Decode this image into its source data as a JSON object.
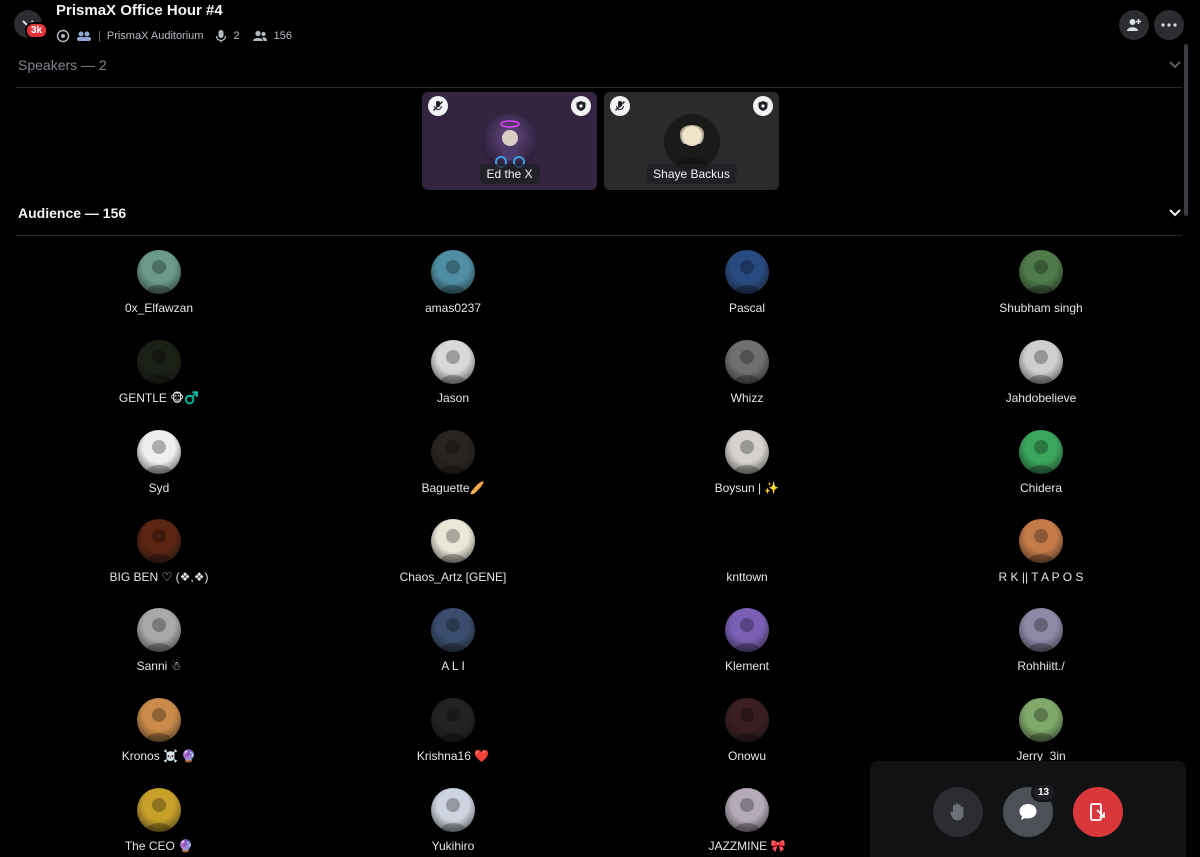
{
  "header": {
    "server_badge": "3k",
    "title": "PrismaX Office Hour #4",
    "channel": "PrismaX Auditorium",
    "speaker_count": "2",
    "listener_count": "156",
    "icons": [
      "stage-icon",
      "members-icon",
      "mic-icon",
      "people-icon",
      "invite-icon",
      "more-icon"
    ]
  },
  "speakers": {
    "label": "Speakers — 2",
    "items": [
      {
        "name": "Ed the X",
        "bg": "#33243f"
      },
      {
        "name": "Shaye Backus",
        "bg": "#2b2b2e"
      }
    ]
  },
  "audience": {
    "label": "Audience — 156",
    "members": [
      {
        "name": "0x_Elfawzan",
        "color": "#6b9a8a"
      },
      {
        "name": "amas0237",
        "color": "#4f8ea3"
      },
      {
        "name": "Pascal",
        "color": "#294a80"
      },
      {
        "name": "Shubham singh",
        "color": "#4f7a4a"
      },
      {
        "name": "GENTLE 🐵♂️",
        "color": "#1c2117"
      },
      {
        "name": "Jason",
        "color": "#d9d9d9"
      },
      {
        "name": "Whizz",
        "color": "#6f6f6f"
      },
      {
        "name": "Jahdobelieve",
        "color": "#cfcfcf"
      },
      {
        "name": "Syd",
        "color": "#efefef"
      },
      {
        "name": "Baguette🥖",
        "color": "#2a2420"
      },
      {
        "name": "Boysun | ✨",
        "color": "#d6d3cf"
      },
      {
        "name": "Chidera",
        "color": "#3ba55c"
      },
      {
        "name": "BIG BEN ♡ (❖,❖)",
        "color": "#5a2512"
      },
      {
        "name": "Chaos_Artz [GENE]",
        "color": "#eae6d8"
      },
      {
        "name": "knttown",
        "color": ""
      },
      {
        "name": "R K || T A P O S",
        "color": "#c47a49"
      },
      {
        "name": "Sanni ☃",
        "color": "#a9a9a9"
      },
      {
        "name": "A L I",
        "color": "#3a4d6e"
      },
      {
        "name": "Klement",
        "color": "#7a5fb5"
      },
      {
        "name": "Rohhiitt./",
        "color": "#8c8aa6"
      },
      {
        "name": "Kronos ☠️ 🔮",
        "color": "#c98a4a"
      },
      {
        "name": "Krishna16 ❤️",
        "color": "#222222"
      },
      {
        "name": "Onowu",
        "color": "#3a1e22"
      },
      {
        "name": "Jerry_3in",
        "color": "#7fa86a"
      },
      {
        "name": "The  CEO 🔮",
        "color": "#c7a02a"
      },
      {
        "name": "Yukihiro",
        "color": "#cfd5e0"
      },
      {
        "name": "JAZZMINE 🎀",
        "color": "#b5aab8"
      }
    ]
  },
  "controls": {
    "chat_count": "13",
    "colors": {
      "raise_hand": "#2b2d31",
      "chat": "#4e5058",
      "leave": "#da373c"
    }
  }
}
